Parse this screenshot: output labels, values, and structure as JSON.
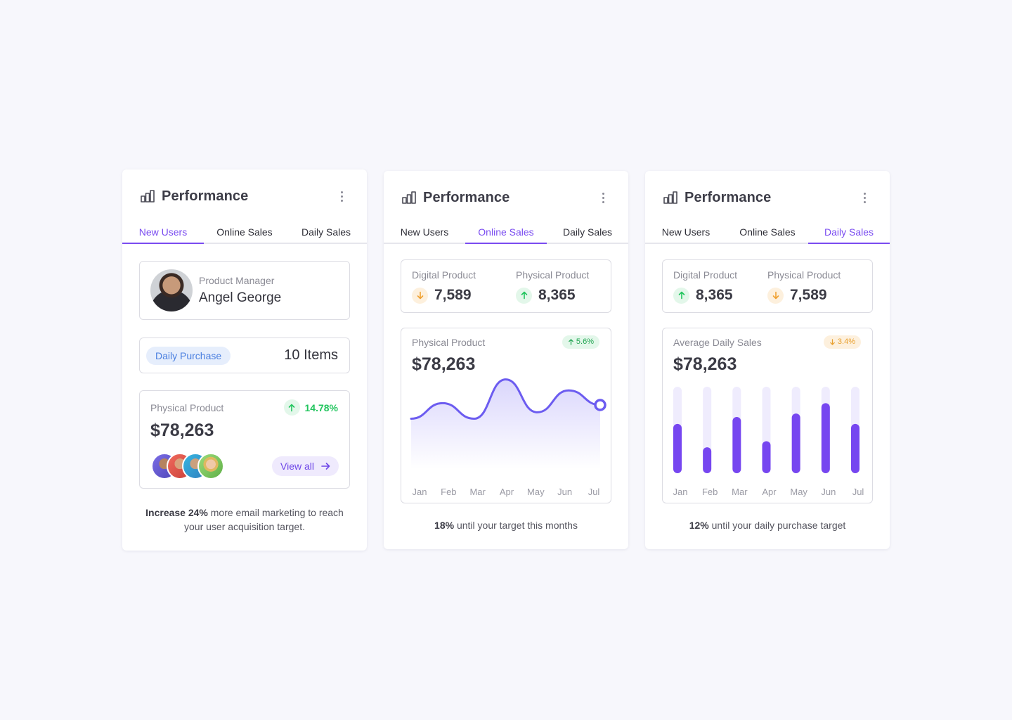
{
  "colors": {
    "accent": "#7a4cf0",
    "up": "#22c55e",
    "down": "#f0a030",
    "background": "#f7f7fc"
  },
  "cards": [
    {
      "title": "Performance",
      "tabs": [
        "New Users",
        "Online Sales",
        "Daily Sales"
      ],
      "active_tab": 0,
      "profile": {
        "role": "Product Manager",
        "name": "Angel George"
      },
      "purchase": {
        "label": "Daily Purchase",
        "count": "10 Items"
      },
      "product": {
        "label": "Physical Product",
        "growth": "14.78%",
        "amount": "$78,263",
        "view_all": "View all"
      },
      "footer": {
        "bold": "Increase 24%",
        "text": " more email marketing to reach your user acquisition target."
      }
    },
    {
      "title": "Performance",
      "tabs": [
        "New Users",
        "Online Sales",
        "Daily Sales"
      ],
      "active_tab": 1,
      "stats": [
        {
          "label": "Digital Product",
          "value": "7,589",
          "trend": "down"
        },
        {
          "label": "Physical Product",
          "value": "8,365",
          "trend": "up"
        }
      ],
      "chart": {
        "label": "Physical Product",
        "amount": "$78,263",
        "badge": "5.6%",
        "badge_trend": "up"
      },
      "footer": {
        "bold": "18%",
        "text": " until your target this months"
      }
    },
    {
      "title": "Performance",
      "tabs": [
        "New Users",
        "Online Sales",
        "Daily Sales"
      ],
      "active_tab": 2,
      "stats": [
        {
          "label": "Digital Product",
          "value": "8,365",
          "trend": "up"
        },
        {
          "label": "Physical Product",
          "value": "7,589",
          "trend": "down"
        }
      ],
      "chart": {
        "label": "Average Daily Sales",
        "amount": "$78,263",
        "badge": "3.4%",
        "badge_trend": "down"
      },
      "footer": {
        "bold": "12%",
        "text": " until your daily purchase target"
      }
    }
  ],
  "chart_data": [
    {
      "type": "area",
      "categories": [
        "Jan",
        "Feb",
        "Mar",
        "Apr",
        "May",
        "Jun",
        "Jul"
      ],
      "series": [
        {
          "values": [
            0.55,
            0.72,
            0.55,
            0.98,
            0.62,
            0.86,
            0.7
          ]
        }
      ],
      "ylim": [
        0,
        1
      ],
      "grid": false
    },
    {
      "type": "bar",
      "categories": [
        "Jan",
        "Feb",
        "Mar",
        "Apr",
        "May",
        "Jun",
        "Jul"
      ],
      "series": [
        {
          "values": [
            0.57,
            0.3,
            0.65,
            0.37,
            0.69,
            0.81,
            0.57
          ]
        }
      ],
      "ylim": [
        0,
        1
      ],
      "grid": false
    }
  ]
}
